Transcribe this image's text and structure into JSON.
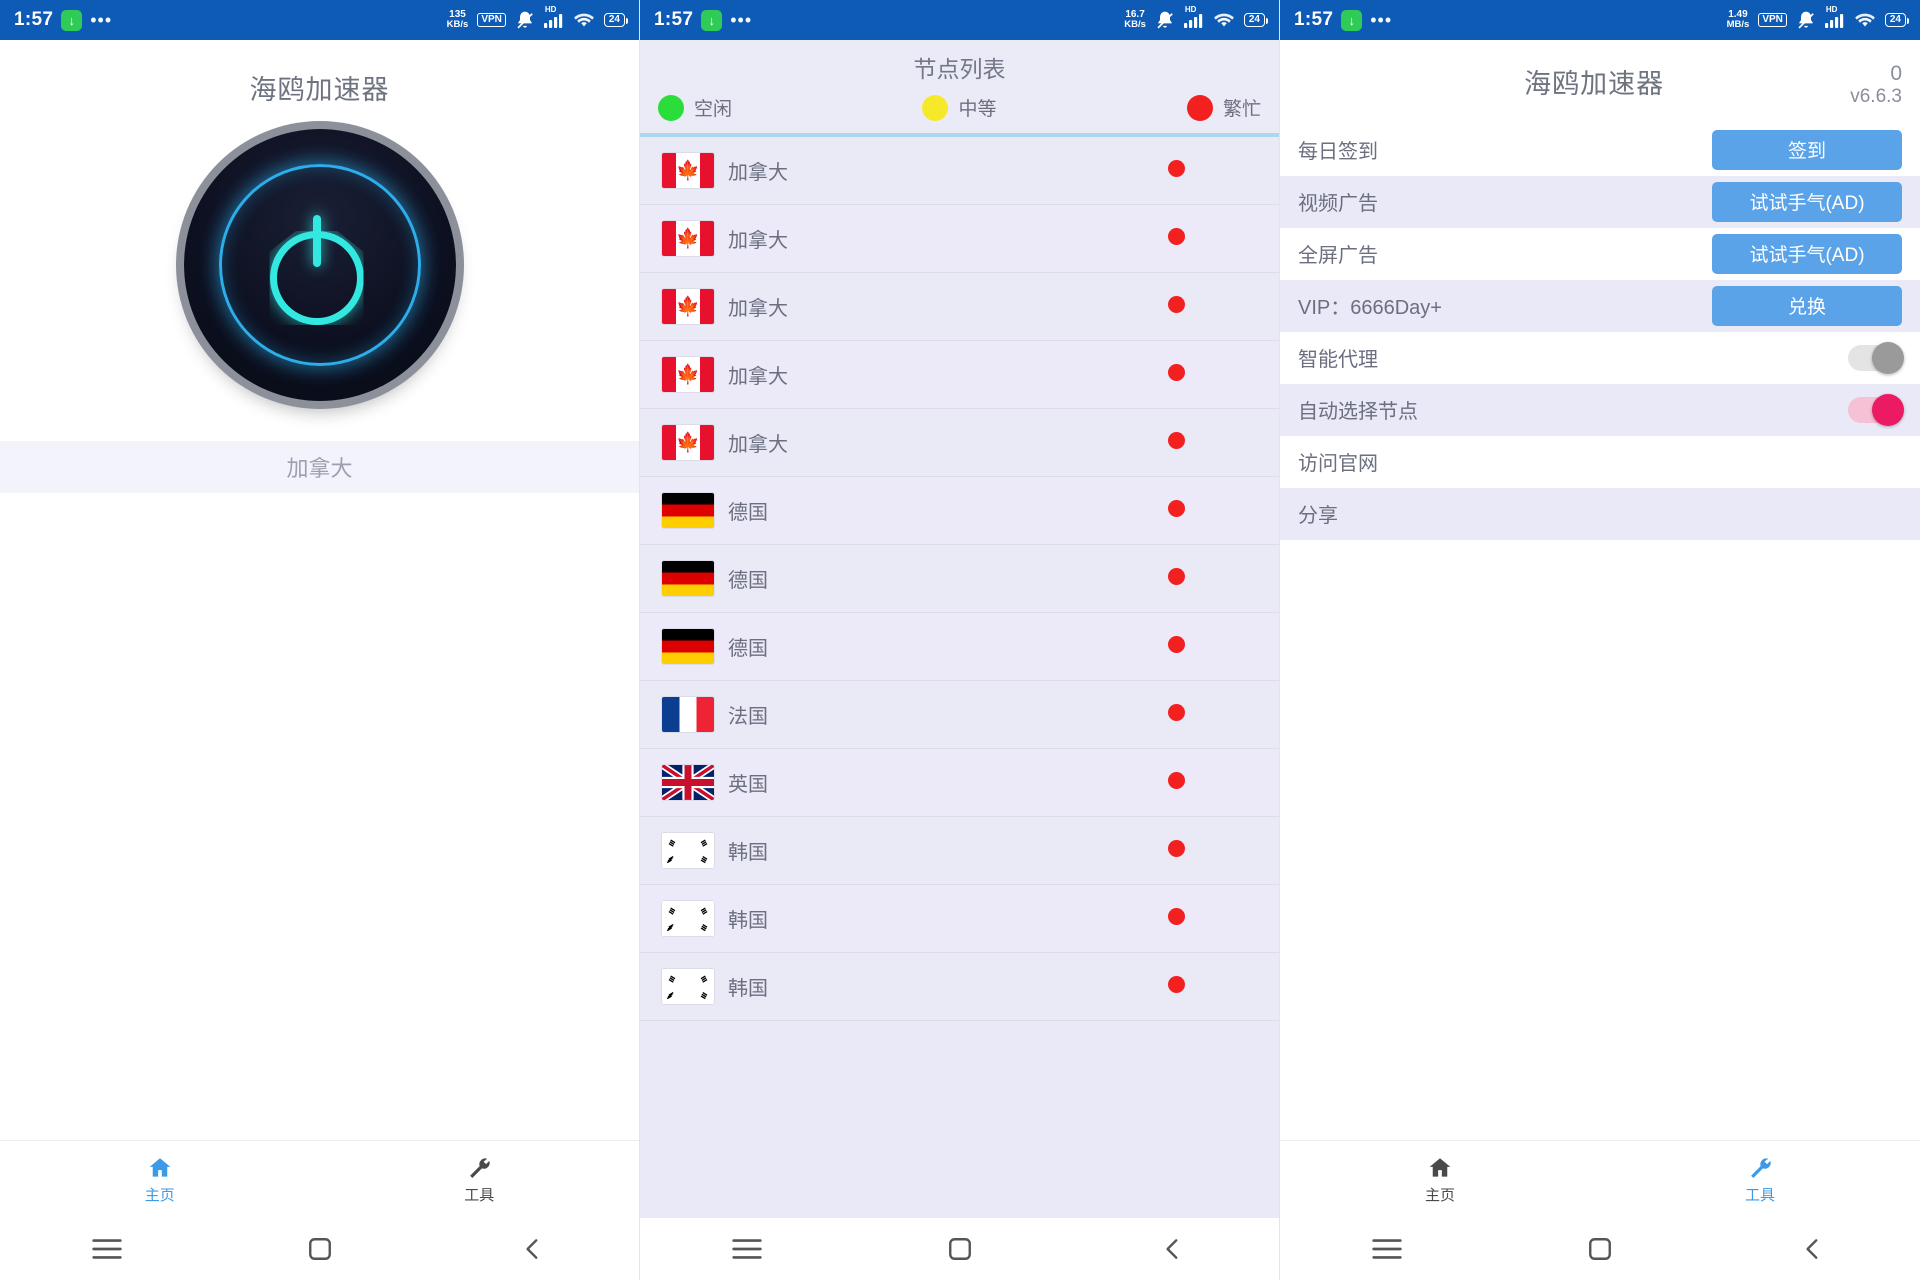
{
  "colors": {
    "status_bar_bg": "#0d5bb5",
    "accent_blue": "#5ba3e8",
    "active_tab": "#3d9ae8",
    "toggle_on": "#ec1a63",
    "toggle_off": "#9a9a9a",
    "busy_red": "#f32020",
    "idle_green": "#2bdd3b",
    "medium_yellow": "#f5e92a",
    "row_bg": "#e9e9f7"
  },
  "panels": [
    {
      "status_bar": {
        "time": "1:57",
        "download_icon": "download-icon",
        "more_dots": "•••",
        "speed_value": "135",
        "speed_unit": "KB/s",
        "vpn_label": "VPN",
        "vpn_visible": true,
        "mute_icon": "bell-muted-icon",
        "hd_label": "HD",
        "signal_icon": "signal-bars-icon",
        "wifi_icon": "wifi-icon",
        "wifi_gen": "6",
        "battery_level": "24"
      },
      "home": {
        "app_title": "海鸥加速器",
        "power_button_name": "power-button",
        "power_state": "off",
        "location": "加拿大"
      },
      "tabs": [
        {
          "label": "主页",
          "icon": "home-icon",
          "active": true
        },
        {
          "label": "工具",
          "icon": "wrench-icon",
          "active": false
        }
      ],
      "nav": [
        {
          "icon": "menu-icon"
        },
        {
          "icon": "square-icon"
        },
        {
          "icon": "back-icon"
        }
      ]
    },
    {
      "status_bar": {
        "time": "1:57",
        "download_icon": "download-icon",
        "more_dots": "•••",
        "speed_value": "16.7",
        "speed_unit": "KB/s",
        "vpn_label": "VPN",
        "vpn_visible": false,
        "mute_icon": "bell-muted-icon",
        "hd_label": "HD",
        "signal_icon": "signal-bars-icon",
        "wifi_icon": "wifi-icon",
        "wifi_gen": "6",
        "battery_level": "24"
      },
      "node_list": {
        "title": "节点列表",
        "legend": [
          {
            "label": "空闲",
            "color": "#2bdd3b"
          },
          {
            "label": "中等",
            "color": "#f5e92a"
          },
          {
            "label": "繁忙",
            "color": "#f32020"
          }
        ],
        "rows": [
          {
            "name": "加拿大",
            "flag": "ca",
            "status": "busy",
            "status_color": "#f32020"
          },
          {
            "name": "加拿大",
            "flag": "ca",
            "status": "busy",
            "status_color": "#f32020"
          },
          {
            "name": "加拿大",
            "flag": "ca",
            "status": "busy",
            "status_color": "#f32020"
          },
          {
            "name": "加拿大",
            "flag": "ca",
            "status": "busy",
            "status_color": "#f32020"
          },
          {
            "name": "加拿大",
            "flag": "ca",
            "status": "busy",
            "status_color": "#f32020"
          },
          {
            "name": "德国",
            "flag": "de",
            "status": "busy",
            "status_color": "#f32020"
          },
          {
            "name": "德国",
            "flag": "de",
            "status": "busy",
            "status_color": "#f32020"
          },
          {
            "name": "德国",
            "flag": "de",
            "status": "busy",
            "status_color": "#f32020"
          },
          {
            "name": "法国",
            "flag": "fr",
            "status": "busy",
            "status_color": "#f32020"
          },
          {
            "name": "英国",
            "flag": "gb",
            "status": "busy",
            "status_color": "#f32020"
          },
          {
            "name": "韩国",
            "flag": "kr",
            "status": "busy",
            "status_color": "#f32020"
          },
          {
            "name": "韩国",
            "flag": "kr",
            "status": "busy",
            "status_color": "#f32020"
          },
          {
            "name": "韩国",
            "flag": "kr",
            "status": "busy",
            "status_color": "#f32020"
          }
        ]
      },
      "nav": [
        {
          "icon": "menu-icon"
        },
        {
          "icon": "square-icon"
        },
        {
          "icon": "back-icon"
        }
      ]
    },
    {
      "status_bar": {
        "time": "1:57",
        "download_icon": "download-icon",
        "more_dots": "•••",
        "speed_value": "1.49",
        "speed_unit": "MB/s",
        "vpn_label": "VPN",
        "vpn_visible": true,
        "mute_icon": "bell-muted-icon",
        "hd_label": "HD",
        "signal_icon": "signal-bars-icon",
        "wifi_icon": "wifi-icon",
        "wifi_gen": "6",
        "battery_level": "24"
      },
      "tools": {
        "app_title": "海鸥加速器",
        "count": "0",
        "version": "v6.6.3",
        "rows": [
          {
            "label": "每日签到",
            "control": "button",
            "button_label": "签到",
            "alt": false
          },
          {
            "label": "视频广告",
            "control": "button",
            "button_label": "试试手气(AD)",
            "alt": true
          },
          {
            "label": "全屏广告",
            "control": "button",
            "button_label": "试试手气(AD)",
            "alt": false
          },
          {
            "label": "VIP：6666Day+",
            "control": "button",
            "button_label": "兑换",
            "alt": true
          },
          {
            "label": "智能代理",
            "control": "toggle",
            "toggle_on": false,
            "alt": false
          },
          {
            "label": "自动选择节点",
            "control": "toggle",
            "toggle_on": true,
            "alt": true
          },
          {
            "label": "访问官网",
            "control": "none",
            "alt": false
          },
          {
            "label": "分享",
            "control": "none",
            "alt": true
          }
        ]
      },
      "tabs": [
        {
          "label": "主页",
          "icon": "home-icon",
          "active": false
        },
        {
          "label": "工具",
          "icon": "wrench-icon",
          "active": true
        }
      ],
      "nav": [
        {
          "icon": "menu-icon"
        },
        {
          "icon": "square-icon"
        },
        {
          "icon": "back-icon"
        }
      ]
    }
  ]
}
